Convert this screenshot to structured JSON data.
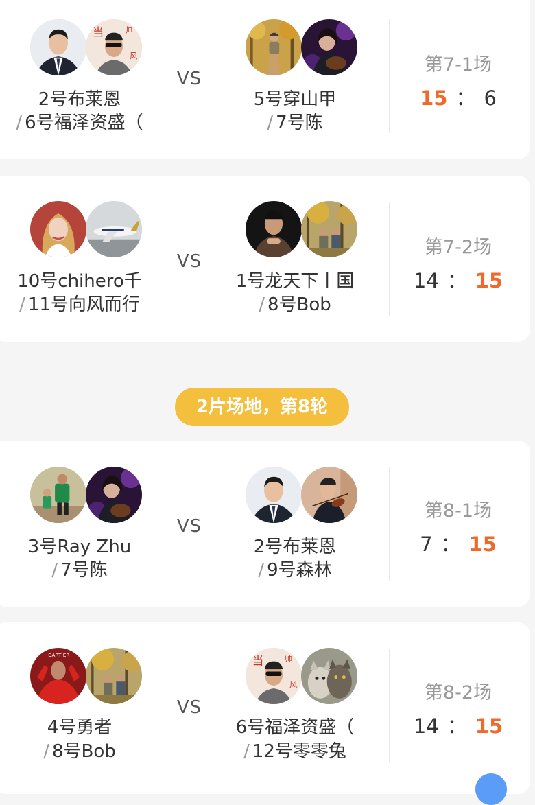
{
  "round_header": {
    "label": "2片场地，第8轮"
  },
  "matches": [
    {
      "round": "第7-1场",
      "team_a": {
        "p1": "2号布莱恩",
        "p2": "6号福泽资盛（",
        "avatars": [
          "man-in-suit",
          "sticker-man-sunglasses"
        ]
      },
      "team_b": {
        "p1": "5号穿山甲",
        "p2": "7号陈",
        "avatars": [
          "hiker-autumn-forest",
          "woman-guitar-purple"
        ]
      },
      "score_a": "15",
      "score_b": "6",
      "winner": "a"
    },
    {
      "round": "第7-2场",
      "team_a": {
        "p1": "10号chihero千",
        "p2": "11号向风而行",
        "avatars": [
          "woman-blonde-selfie",
          "airplane-airport"
        ]
      },
      "team_b": {
        "p1": "1号龙天下丨国",
        "p2": "8号Bob",
        "avatars": [
          "man-dark-portrait",
          "group-autumn-trees"
        ]
      },
      "score_a": "14",
      "score_b": "15",
      "winner": "b"
    },
    {
      "round": "第8-1场",
      "team_a": {
        "p1": "3号Ray Zhu",
        "p2": "7号陈",
        "avatars": [
          "father-child-green",
          "woman-guitar-purple"
        ]
      },
      "team_b": {
        "p1": "2号布莱恩",
        "p2": "9号森林",
        "avatars": [
          "man-in-suit",
          "violinist"
        ]
      },
      "score_a": "7",
      "score_b": "15",
      "winner": "b"
    },
    {
      "round": "第8-2场",
      "team_a": {
        "p1": "4号勇者",
        "p2": "8号Bob",
        "avatars": [
          "player-red-jersey",
          "group-autumn-trees"
        ]
      },
      "team_b": {
        "p1": "6号福泽资盛（",
        "p2": "12号零零兔",
        "avatars": [
          "sticker-man-sunglasses",
          "two-cats"
        ]
      },
      "score_a": "14",
      "score_b": "15",
      "winner": "b"
    }
  ],
  "vs_label": "VS",
  "colon": "：",
  "slash": "/",
  "colors": {
    "accent": "#ee6a2b",
    "pill": "#f4bf3d",
    "fab": "#5a9cf8"
  }
}
